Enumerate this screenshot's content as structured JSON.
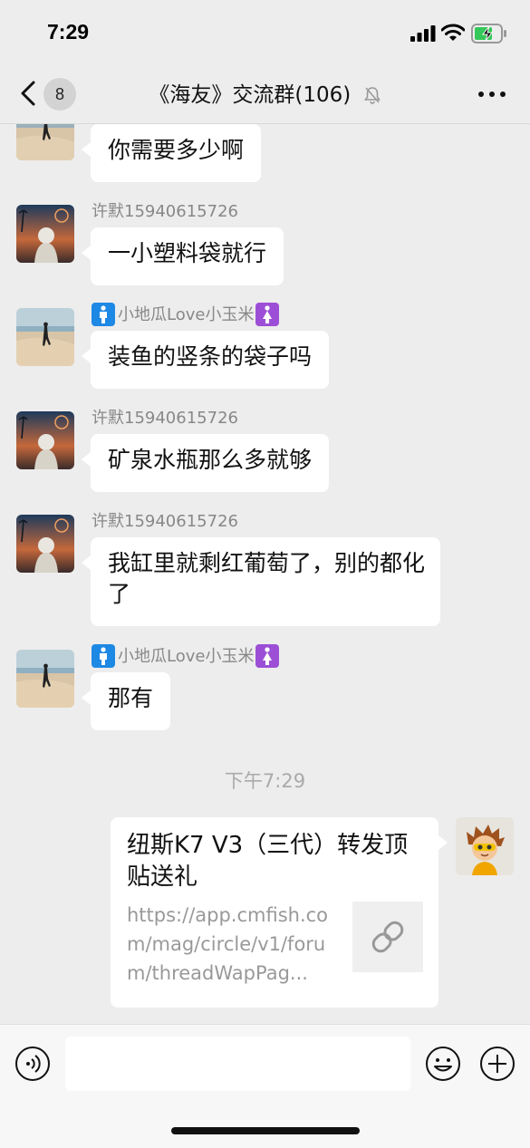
{
  "status": {
    "time": "7:29"
  },
  "header": {
    "back_count": "8",
    "title": "《海友》交流群(106)"
  },
  "messages": [
    {
      "sender": "",
      "text": "你需要多少啊"
    },
    {
      "sender": "许默15940615726",
      "text": "一小塑料袋就行"
    },
    {
      "sender": "小地瓜Love小玉米",
      "text": "装鱼的竖条的袋子吗"
    },
    {
      "sender": "许默15940615726",
      "text": "矿泉水瓶那么多就够"
    },
    {
      "sender": "许默15940615726",
      "text": "我缸里就剩红葡萄了，别的都化了"
    },
    {
      "sender": "小地瓜Love小玉米",
      "text": "那有"
    }
  ],
  "timestamp": "下午7:29",
  "link_card": {
    "title": "纽斯K7 V3（三代）转发顶贴送礼",
    "url": "https://app.cmfish.com/mag/circle/v1/forum/threadWapPag..."
  },
  "input": {
    "placeholder": ""
  },
  "icons": {
    "back": "chevron-left-icon",
    "mute": "bell-muted-icon",
    "more": "ellipsis-icon",
    "voice": "voice-icon",
    "emoji": "emoji-icon",
    "plus": "plus-icon",
    "link": "link-icon",
    "male": "man-symbol-icon",
    "female": "woman-symbol-icon"
  },
  "colors": {
    "background": "#ededed",
    "bubble": "#ffffff",
    "badge_male": "#1e88e5",
    "badge_female": "#9c4fd6"
  }
}
